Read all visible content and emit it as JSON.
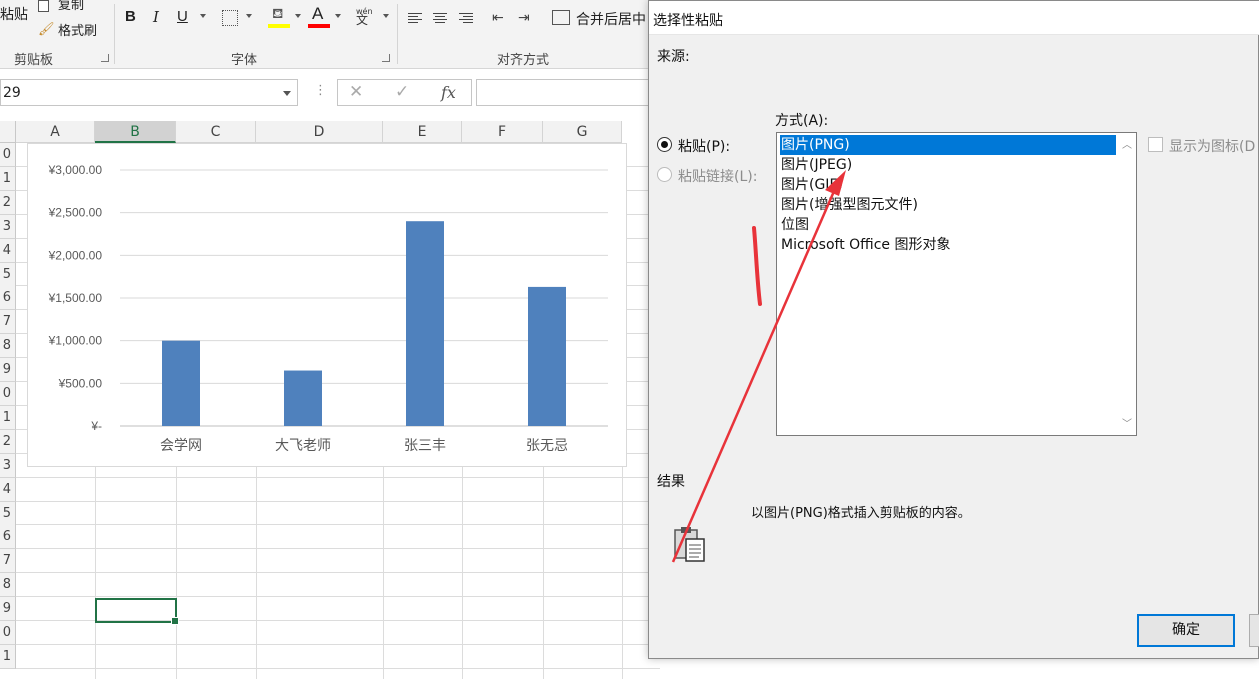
{
  "ribbon": {
    "paste_label": "粘贴",
    "copy_label": "复制",
    "format_painter_label": "格式刷",
    "clipboard_group": "剪贴板",
    "font_group": "字体",
    "alignment_group": "对齐方式",
    "bold": "B",
    "italic": "I",
    "underline": "U",
    "font_color_glyph": "A",
    "merge_center_label": "合并后居中",
    "phonetic_glyph": "wén"
  },
  "formula_bar": {
    "name_box": "29",
    "fx_label": "fx",
    "cancel_glyph": "✕",
    "enter_glyph": "✓"
  },
  "columns": [
    "A",
    "B",
    "C",
    "D",
    "E",
    "F",
    "G"
  ],
  "rows": [
    "0",
    "1",
    "2",
    "3",
    "4",
    "5",
    "6",
    "7",
    "8",
    "9",
    "0",
    "1",
    "2",
    "3",
    "4",
    "5",
    "6",
    "7",
    "8",
    "9",
    "0",
    "1"
  ],
  "chart_data": {
    "type": "bar",
    "categories": [
      "会学网",
      "大飞老师",
      "张三丰",
      "张无忌"
    ],
    "values": [
      1000,
      650,
      2400,
      1630
    ],
    "ylim": [
      0,
      3000
    ],
    "yticks": [
      "¥3,000.00",
      "¥2,500.00",
      "¥2,000.00",
      "¥1,500.00",
      "¥1,000.00",
      "¥500.00",
      "¥-"
    ],
    "color": "#4f81bd",
    "grid": true
  },
  "dialog": {
    "title": "选择性粘贴",
    "source_label": "来源:",
    "as_label": "方式(A):",
    "paste_radio": "粘贴(P):",
    "paste_link_radio": "粘贴链接(L):",
    "display_as_icon": "显示为图标(D",
    "options": [
      "图片(PNG)",
      "图片(JPEG)",
      "图片(GIF)",
      "图片(增强型图元文件)",
      "位图",
      "Microsoft Office 图形对象"
    ],
    "selected_index": 0,
    "result_label": "结果",
    "result_text": "以图片(PNG)格式插入剪贴板的内容。",
    "ok_button": "确定"
  },
  "colors": {
    "accent": "#0078d7",
    "excel_green": "#217346",
    "annotation_red": "#e8333a"
  }
}
